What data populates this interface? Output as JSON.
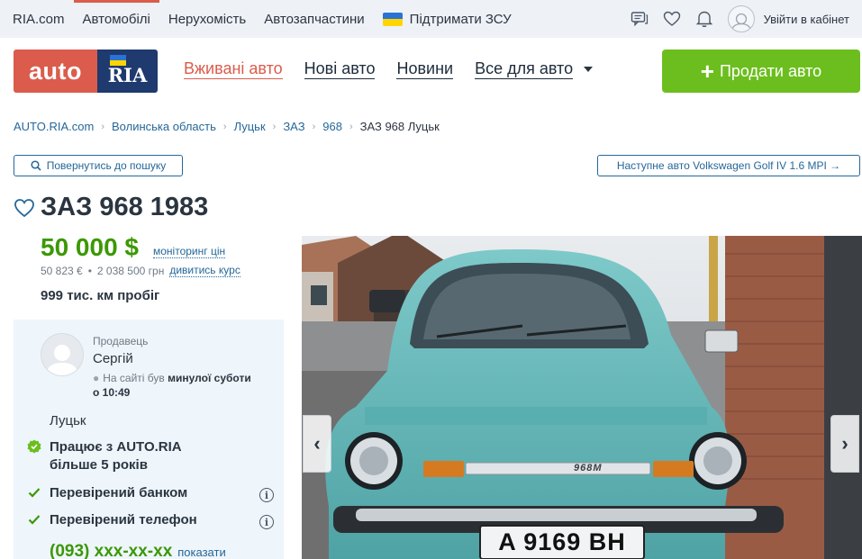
{
  "topnav": {
    "items": [
      "RIA.com",
      "Автомобілі",
      "Нерухомість",
      "Автозапчастини"
    ],
    "support": "Підтримати ЗСУ",
    "login": "Увійти в кабінет"
  },
  "header": {
    "logo_auto": "auto",
    "logo_ria": "RIA",
    "nav": [
      "Вживані авто",
      "Нові авто",
      "Новини",
      "Все для авто"
    ],
    "sell_button": "Продати авто"
  },
  "breadcrumbs": [
    "AUTO.RIA.com",
    "Волинська область",
    "Луцьк",
    "ЗАЗ",
    "968",
    "ЗАЗ 968 Луцьк"
  ],
  "back_button": "Повернутись до пошуку",
  "next_button": "Наступне авто Volkswagen Golf IV 1.6 MPI →",
  "listing": {
    "title": "ЗАЗ 968 1983",
    "price": "50 000 $",
    "monitoring": "моніторинг цін",
    "price_eur": "50 823 €",
    "price_uah": "2 038 500  грн",
    "rate_link": "дивитись курс",
    "mileage": "999 тис. км пробіг"
  },
  "seller": {
    "role": "Продавець",
    "name": "Сергій",
    "seen_prefix": "На сайті був ",
    "seen_bold_1": "минулої суботи",
    "seen_bold_2": "о 10:49",
    "city": "Луцьк",
    "feature_1": "Працює з AUTO.RIA",
    "feature_1b": "більше 5 років",
    "feature_2": "Перевірений банком",
    "feature_3": "Перевірений телефон",
    "phone": "(093) xxx-xx-xx",
    "show_phone": "показати"
  },
  "photo": {
    "plate": "A 9169 BH",
    "badge": "968M",
    "prev": "‹",
    "next": "›"
  },
  "colors": {
    "accent_red": "#db5c4c",
    "navy": "#1e3a6e",
    "green": "#6cbe1e",
    "price_green": "#3c9806",
    "link": "#256799",
    "car_body": "#5fb3b4"
  }
}
